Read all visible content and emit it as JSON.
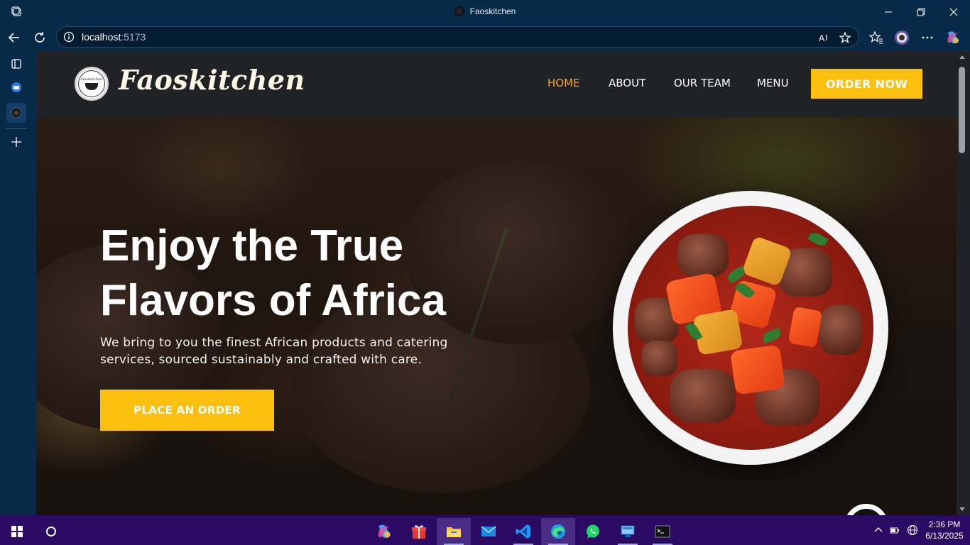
{
  "window": {
    "title": "Faoskitchen"
  },
  "address_bar": {
    "host": "localhost",
    "port": ":5173"
  },
  "site": {
    "brand": "Faoskitchen",
    "logo_text": "Faoskitchen",
    "nav": [
      {
        "label": "HOME",
        "active": true
      },
      {
        "label": "ABOUT",
        "active": false
      },
      {
        "label": "OUR TEAM",
        "active": false
      },
      {
        "label": "MENU",
        "active": false
      }
    ],
    "order_now_label": "ORDER NOW"
  },
  "hero": {
    "title_line1": "Enjoy the True",
    "title_line2": "Flavors of Africa",
    "subtitle_line1": "We bring to you the finest African products and catering",
    "subtitle_line2": "services, sourced sustainably and crafted with care.",
    "cta_label": "PLACE AN ORDER"
  },
  "colors": {
    "accent": "#fbbf0e",
    "active_nav": "#f5a623",
    "header_bg": "#212226",
    "taskbar_bg": "#2a0a63"
  },
  "taskbar": {
    "time": "2:36 PM",
    "date": "6/13/2025"
  }
}
